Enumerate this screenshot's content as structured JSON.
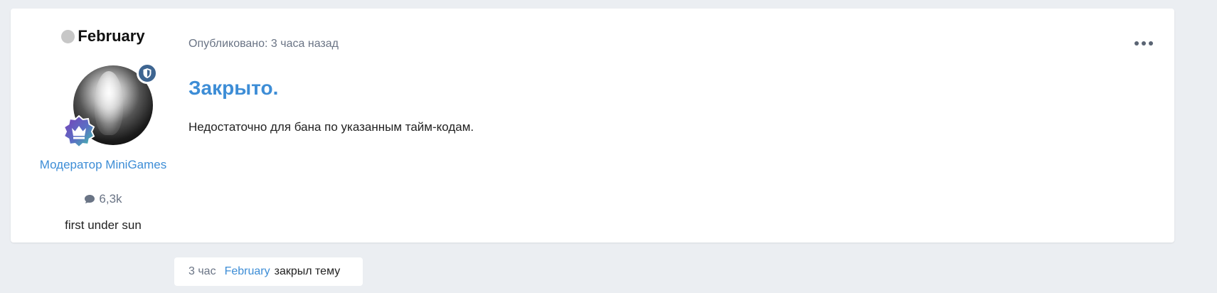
{
  "author": {
    "name": "February",
    "group": "Модератор MiniGames",
    "posts_count": "6,3k",
    "user_title": "first under sun"
  },
  "post": {
    "meta": "Опубликовано: 3 часа назад",
    "heading": "Закрыто.",
    "body": "Недостаточно для бана по указанным тайм-кодам."
  },
  "event": {
    "time": "3 час",
    "user": "February",
    "action": "закрыл тему"
  },
  "colors": {
    "accent": "#3d8dd6",
    "background": "#ebeef2",
    "mod_badge": "#3e6591",
    "muted": "#6a7485"
  },
  "icons": {
    "status": "offline-status-dot",
    "mod_badge": "shield-icon",
    "rank_badge": "crown-icon",
    "posts": "comment-icon",
    "menu": "more-horizontal-icon"
  }
}
